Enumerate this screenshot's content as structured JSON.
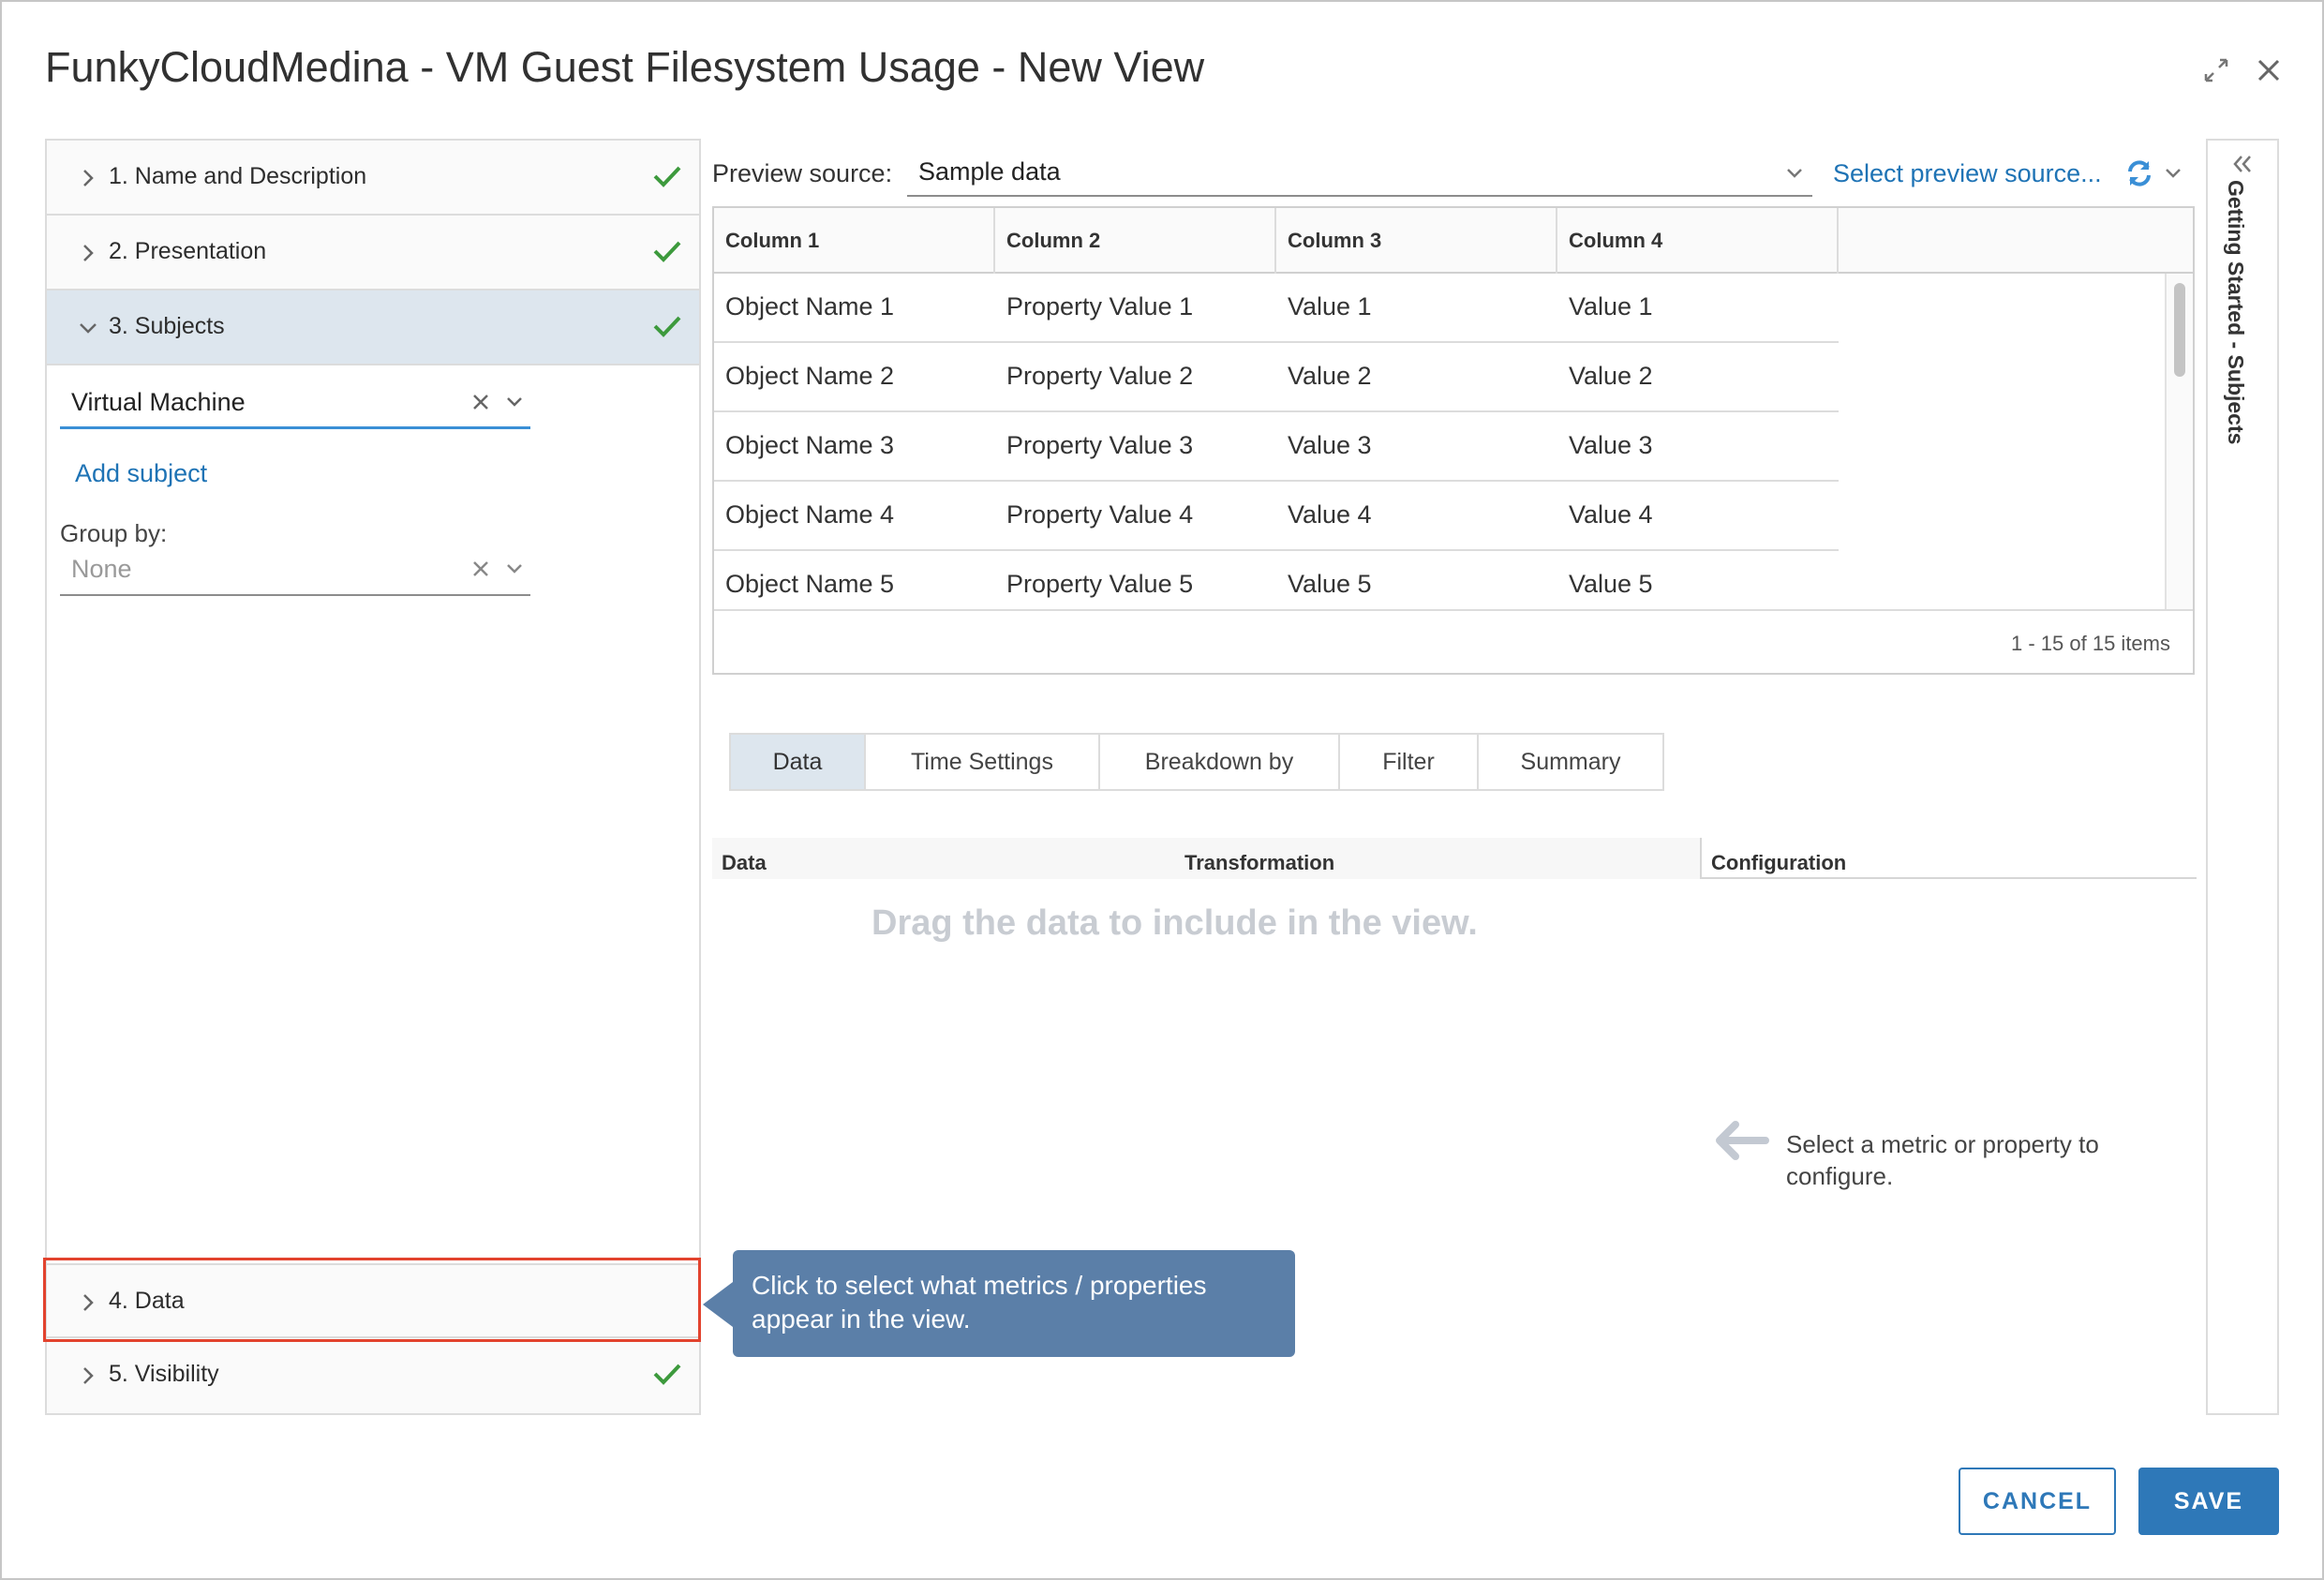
{
  "dialog": {
    "title": "FunkyCloudMedina - VM Guest Filesystem Usage - New View"
  },
  "wizard": {
    "steps": [
      {
        "label": "1. Name and Description",
        "complete": true,
        "expanded": false
      },
      {
        "label": "2. Presentation",
        "complete": true,
        "expanded": false
      },
      {
        "label": "3. Subjects",
        "complete": true,
        "expanded": true
      },
      {
        "label": "4. Data",
        "complete": false,
        "expanded": false
      },
      {
        "label": "5. Visibility",
        "complete": true,
        "expanded": false
      }
    ],
    "subject_value": "Virtual Machine",
    "add_subject_label": "Add subject",
    "group_by_label": "Group by:",
    "group_by_value": "None"
  },
  "preview": {
    "source_label": "Preview source:",
    "source_value": "Sample data",
    "select_source_link": "Select preview source...",
    "columns": [
      "Column 1",
      "Column 2",
      "Column 3",
      "Column 4"
    ],
    "rows": [
      [
        "Object Name 1",
        "Property Value 1",
        "Value 1",
        "Value 1"
      ],
      [
        "Object Name 2",
        "Property Value 2",
        "Value 2",
        "Value 2"
      ],
      [
        "Object Name 3",
        "Property Value 3",
        "Value 3",
        "Value 3"
      ],
      [
        "Object Name 4",
        "Property Value 4",
        "Value 4",
        "Value 4"
      ],
      [
        "Object Name 5",
        "Property Value 5",
        "Value 5",
        "Value 5"
      ]
    ],
    "footer": "1 - 15 of 15 items"
  },
  "tabs": [
    {
      "label": "Data",
      "active": true
    },
    {
      "label": "Time Settings",
      "active": false
    },
    {
      "label": "Breakdown by",
      "active": false
    },
    {
      "label": "Filter",
      "active": false
    },
    {
      "label": "Summary",
      "active": false
    }
  ],
  "data_panel": {
    "headers": {
      "data": "Data",
      "transformation": "Transformation",
      "configuration": "Configuration"
    },
    "drag_hint": "Drag the data to include in the view.",
    "config_hint": "Select a metric or property to configure."
  },
  "callout": {
    "text": "Click to select what metrics / properties appear in the view."
  },
  "side_panel": {
    "title": "Getting Started - Subjects"
  },
  "footer": {
    "cancel_label": "CANCEL",
    "save_label": "SAVE"
  },
  "colors": {
    "accent": "#2e78b8",
    "check": "#3d9a3d",
    "highlight": "#e2432e",
    "callout": "#5b7fa8",
    "active_tab": "#dde6ee"
  },
  "icons": {
    "expand": "expand-icon",
    "close": "close-icon",
    "check": "check-icon",
    "chevron_right": "chevron-right-icon",
    "chevron_down": "chevron-down-icon",
    "clear": "clear-icon",
    "refresh": "refresh-icon",
    "collapse_panel": "double-chevron-left-icon",
    "arrow_left": "arrow-left-icon"
  }
}
